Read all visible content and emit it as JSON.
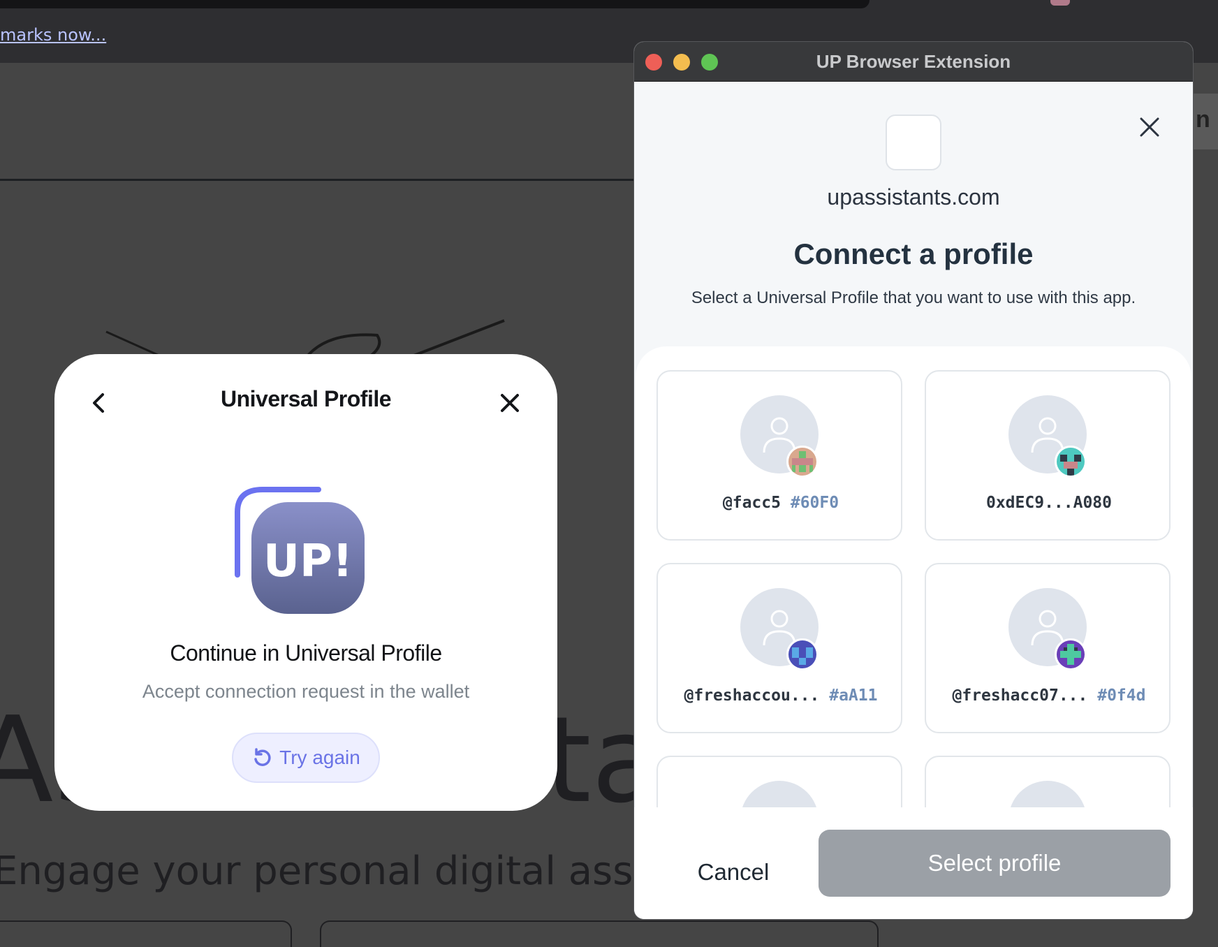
{
  "background": {
    "bookmark_link": "marks now...",
    "hero_left": "As",
    "hero_right": "tal",
    "tagline": "Engage your personal digital assistant",
    "right_button_letter": "n"
  },
  "up_modal": {
    "title": "Universal Profile",
    "logo_text": "UP!",
    "heading": "Continue in Universal Profile",
    "subheading": "Accept connection request in the wallet",
    "try_again_label": "Try again"
  },
  "extension": {
    "window_title": "UP Browser Extension",
    "site": "upassistants.com",
    "heading": "Connect a profile",
    "subheading": "Select a Universal Profile that you want to use with this app.",
    "profiles": [
      {
        "name": "@facc5",
        "hash": "#60F0"
      },
      {
        "name": "0xdEC9...A080",
        "hash": ""
      },
      {
        "name": "@freshaccou...",
        "hash": "#aA11"
      },
      {
        "name": "@freshacc07...",
        "hash": "#0f4d"
      }
    ],
    "cancel_label": "Cancel",
    "select_label": "Select profile"
  }
}
